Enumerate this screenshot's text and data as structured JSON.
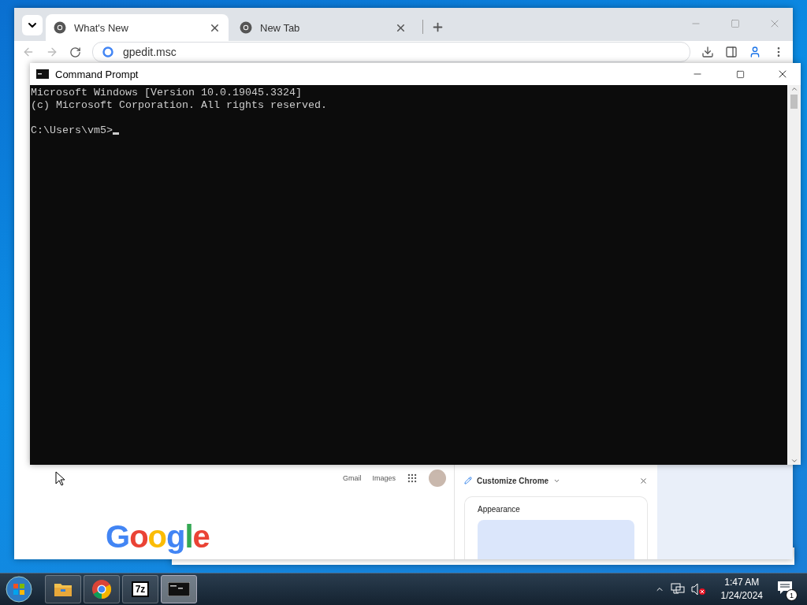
{
  "browser": {
    "tabs": [
      {
        "title": "What's New",
        "selected": true
      },
      {
        "title": "New Tab",
        "selected": false
      }
    ],
    "address": "gpedit.msc",
    "page": {
      "header_links": [
        "Gmail",
        "Images"
      ],
      "logo": "Google"
    },
    "side_panel": {
      "title": "Customize Chrome",
      "section": "Appearance"
    }
  },
  "command_prompt": {
    "title": "Command Prompt",
    "lines": [
      "Microsoft Windows [Version 10.0.19045.3324]",
      "(c) Microsoft Corporation. All rights reserved."
    ],
    "prompt": "C:\\Users\\vm5>"
  },
  "taskbar": {
    "apps": [
      {
        "kind": "explorer",
        "selected": false
      },
      {
        "kind": "chrome",
        "selected": false
      },
      {
        "kind": "archiver",
        "label": "7z",
        "selected": false
      },
      {
        "kind": "terminal",
        "selected": true
      }
    ],
    "volume_muted": true,
    "time": "1:47 AM",
    "date": "1/24/2024",
    "notifications": "1"
  }
}
